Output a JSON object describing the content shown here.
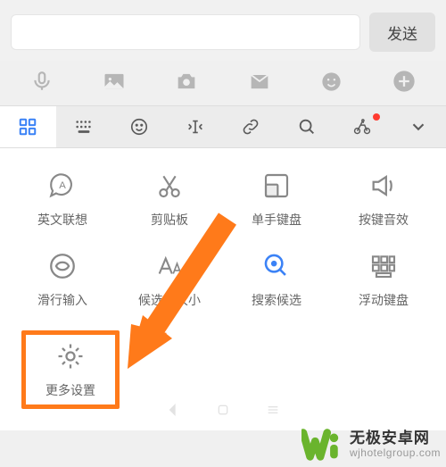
{
  "input": {
    "placeholder": ""
  },
  "send": {
    "label": "发送"
  },
  "tabs": {},
  "gridItems": [
    {
      "label": "英文联想"
    },
    {
      "label": "剪贴板"
    },
    {
      "label": "单手键盘"
    },
    {
      "label": "按键音效"
    },
    {
      "label": "滑行输入"
    },
    {
      "label": "候选字大小"
    },
    {
      "label": "搜索候选"
    },
    {
      "label": "浮动键盘"
    },
    {
      "label": "更多设置"
    }
  ],
  "watermark": {
    "title": "无极安卓网",
    "url": "wjhotelgroup.com"
  },
  "colors": {
    "highlight": "#ff7a1a",
    "active": "#3b82f6"
  }
}
